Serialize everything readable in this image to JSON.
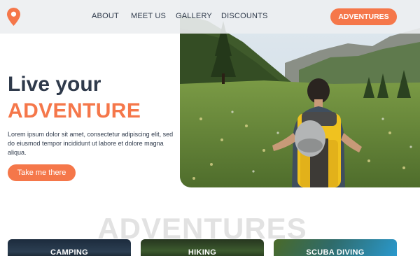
{
  "nav": {
    "items": [
      {
        "label": "ABOUT"
      },
      {
        "label": "MEET US"
      },
      {
        "label": "GALLERY"
      },
      {
        "label": "DISCOUNTS"
      }
    ],
    "cta_label": "ADVENTURES"
  },
  "hero": {
    "title_line1": "Live your",
    "title_line2": "ADVENTURE",
    "text": "Lorem ipsum dolor sit amet, consectetur adipiscing elit, sed do eiusmod tempor incididunt ut labore et dolore magna aliqua.",
    "button_label": "Take me there"
  },
  "adventures": {
    "heading": "ADVENTURES",
    "cards": [
      {
        "label": "CAMPING"
      },
      {
        "label": "HIKING"
      },
      {
        "label": "SCUBA DIVING"
      }
    ]
  },
  "colors": {
    "accent": "#f5774a",
    "text": "#2f3a4b",
    "header_bg": "#eceef1",
    "heading_ghost": "#e2e2e2"
  },
  "icons": {
    "logo": "map-pin-icon"
  }
}
